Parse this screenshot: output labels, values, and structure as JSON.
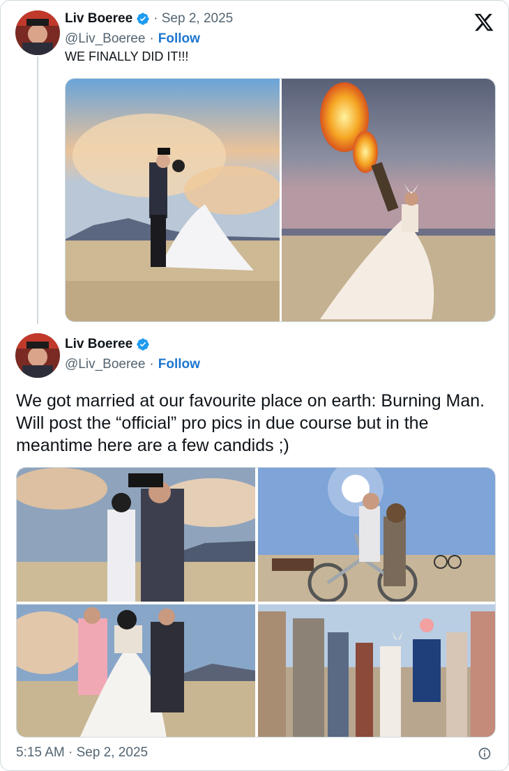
{
  "tweet1": {
    "name": "Liv Boeree",
    "date": "· Sep 2, 2025",
    "handle": "@Liv_Boeree",
    "separator": "·",
    "follow": "Follow",
    "text": "WE FINALLY DID IT!!!"
  },
  "tweet2": {
    "name": "Liv Boeree",
    "handle": "@Liv_Boeree",
    "separator": "·",
    "follow": "Follow",
    "text": "We got married at our favourite place on earth: Burning Man. Will post the “official” pro pics in due course but in the meantime here are a few candids ;)"
  },
  "footer": {
    "timestamp": "5:15 AM · Sep 2, 2025"
  },
  "icons": {
    "logo": "x-logo-icon",
    "verified": "verified-badge-icon",
    "info": "info-icon"
  },
  "colors": {
    "text": "#0f1419",
    "muted": "#536471",
    "follow": "#1d76cf",
    "verified": "#1d9bf0",
    "border": "#cfd9de"
  }
}
